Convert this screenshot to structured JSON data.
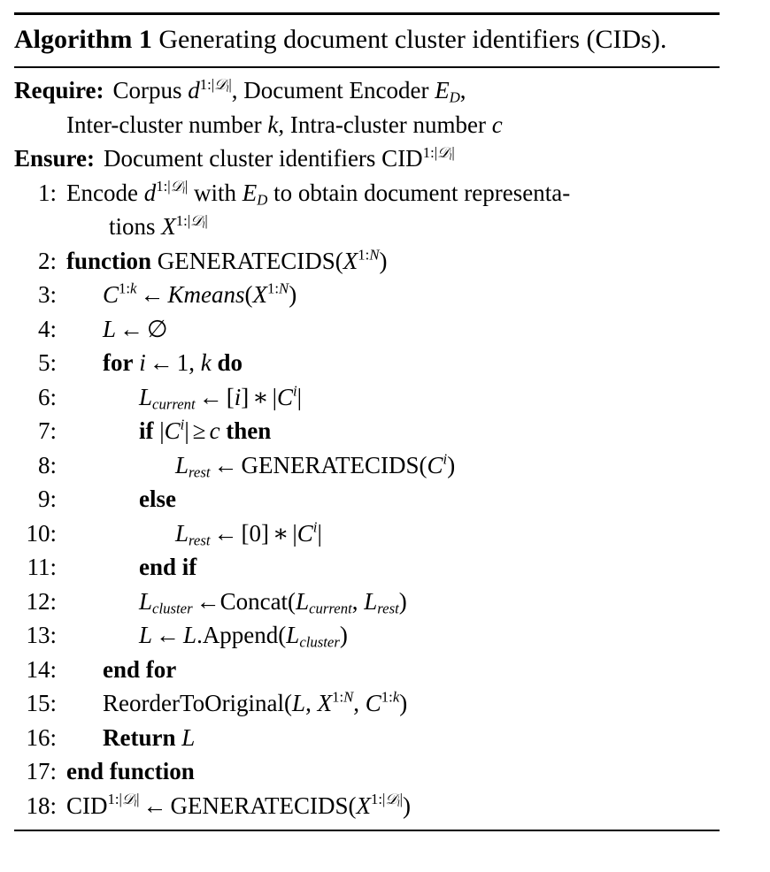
{
  "algorithm": {
    "label": "Algorithm 1",
    "caption": "Generating document cluster identifiers (CIDs).",
    "caption_line1": "Generating document cluster identi-",
    "caption_line2": "fiers (CIDs).",
    "require": {
      "keyword": "Require:",
      "line1": "Corpus d^{1:|D_l|}, Document Encoder E_D,",
      "line2": "Inter-cluster number k, Intra-cluster number c"
    },
    "ensure": {
      "keyword": "Ensure:",
      "line1": "Document cluster identifiers CID^{1:|D_l|}"
    },
    "lines": [
      {
        "n": "1:",
        "indent": 0,
        "text": "Encode d^{1:|D_l|} with E_D to obtain document representations X^{1:|D_l|}"
      },
      {
        "n": "2:",
        "indent": 0,
        "text": "function GENERATECIDS(X^{1:N})"
      },
      {
        "n": "3:",
        "indent": 1,
        "text": "C^{1:k} <- Kmeans(X^{1:N})"
      },
      {
        "n": "4:",
        "indent": 1,
        "text": "L <- ∅"
      },
      {
        "n": "5:",
        "indent": 1,
        "text": "for i <- 1, k do"
      },
      {
        "n": "6:",
        "indent": 2,
        "text": "L_{current} <- [i] * |C^i|"
      },
      {
        "n": "7:",
        "indent": 2,
        "text": "if |C^i| ≥ c then"
      },
      {
        "n": "8:",
        "indent": 3,
        "text": "L_{rest} <- GENERATECIDS(C^i)"
      },
      {
        "n": "9:",
        "indent": 2,
        "text": "else"
      },
      {
        "n": "10:",
        "indent": 3,
        "text": "L_{rest} <- [0] * |C^i|"
      },
      {
        "n": "11:",
        "indent": 2,
        "text": "end if"
      },
      {
        "n": "12:",
        "indent": 2,
        "text": "L_{cluster} <-Concat(L_{current}, L_{rest})"
      },
      {
        "n": "13:",
        "indent": 2,
        "text": "L <- L.Append(L_{cluster})"
      },
      {
        "n": "14:",
        "indent": 1,
        "text": "end for"
      },
      {
        "n": "15:",
        "indent": 1,
        "text": "ReorderToOriginal(L, X^{1:N}, C^{1:k})"
      },
      {
        "n": "16:",
        "indent": 1,
        "text": "Return L"
      },
      {
        "n": "17:",
        "indent": 0,
        "text": "end function"
      },
      {
        "n": "18:",
        "indent": 0,
        "text": "CID^{1:|D_l|} <- GENERATECIDS(X^{1:|D_l|})"
      }
    ],
    "tokens": {
      "encode": "Encode",
      "with": "with",
      "to_obtain": "to obtain document representa-",
      "tions": "tions",
      "function": "function",
      "generatecids": "GENERATECIDS",
      "kmeans": "Kmeans",
      "for": "for",
      "do": "do",
      "if": "if",
      "then": "then",
      "else": "else",
      "end_if": "end if",
      "end_for": "end for",
      "end_function": "end function",
      "return": "Return",
      "concat": "Concat",
      "append": "L.Append",
      "reorder": "ReorderToOriginal",
      "cid": "CID",
      "corpus": "Corpus",
      "document_encoder": "Document Encoder",
      "inter_cluster": "Inter-cluster number",
      "intra_cluster": "Intra-cluster number",
      "doc_cluster_ids": "Document cluster identifiers",
      "arrow": "←",
      "geq": "≥",
      "emptyset": "∅",
      "times": "∗",
      "colon": ":",
      "comma": ",",
      "lparen": "(",
      "rparen": ")",
      "lbrack": "[",
      "rbrack": "]",
      "vbar": "|",
      "one": "1",
      "zero": "0",
      "N": "N",
      "k": "k",
      "c": "c",
      "i": "i",
      "L": "L",
      "C": "C",
      "X": "X",
      "d": "d",
      "E": "E",
      "D": "D",
      "l": "l",
      "sub_current": "current",
      "sub_rest": "rest",
      "sub_cluster": "cluster",
      "calD": "𝒟"
    }
  }
}
